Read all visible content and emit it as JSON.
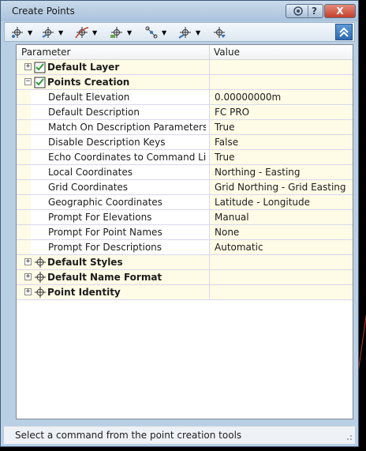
{
  "window": {
    "title": "Create Points",
    "help_label": "?",
    "close_label": "X"
  },
  "toolbar": {
    "tools": [
      {
        "icon": "point-create-icon"
      },
      {
        "icon": "point-intersection-icon"
      },
      {
        "icon": "alignment-point-icon"
      },
      {
        "icon": "surface-point-icon"
      },
      {
        "icon": "interpolate-point-icon"
      },
      {
        "icon": "slope-point-icon"
      },
      {
        "icon": "import-points-icon"
      }
    ],
    "collapse_icon": "double-chevron-up-icon"
  },
  "grid": {
    "header": {
      "parameter": "Parameter",
      "value": "Value"
    },
    "groups": {
      "default_layer": {
        "label": "Default Layer",
        "expander": "+"
      },
      "points_creation": {
        "label": "Points Creation",
        "expander": "−"
      },
      "default_styles": {
        "label": "Default Styles",
        "expander": "+"
      },
      "default_name_format": {
        "label": "Default Name Format",
        "expander": "+"
      },
      "point_identity": {
        "label": "Point Identity",
        "expander": "+"
      }
    },
    "properties": [
      {
        "name": "Default Elevation",
        "value": "0.00000000m"
      },
      {
        "name": "Default Description",
        "value": "FC PRO"
      },
      {
        "name": "Match On Description Parameters ($...",
        "value": "True"
      },
      {
        "name": "Disable Description Keys",
        "value": "False"
      },
      {
        "name": "Echo Coordinates to Command Line",
        "value": "True"
      },
      {
        "name": "Local Coordinates",
        "value": "Northing - Easting"
      },
      {
        "name": "Grid Coordinates",
        "value": "Grid Northing - Grid Easting"
      },
      {
        "name": "Geographic Coordinates",
        "value": "Latitude - Longitude"
      },
      {
        "name": "Prompt For Elevations",
        "value": "Manual"
      },
      {
        "name": "Prompt For Point Names",
        "value": "None"
      },
      {
        "name": "Prompt For Descriptions",
        "value": "Automatic"
      }
    ]
  },
  "status": {
    "text": "Select a command from the point creation tools"
  },
  "colors": {
    "window_frame": "#b9cfe4",
    "value_cell": "#fefbe6",
    "row_line": "#d8d8ee",
    "close_button": "#c4402b",
    "collapse_button": "#2e6bb0"
  }
}
